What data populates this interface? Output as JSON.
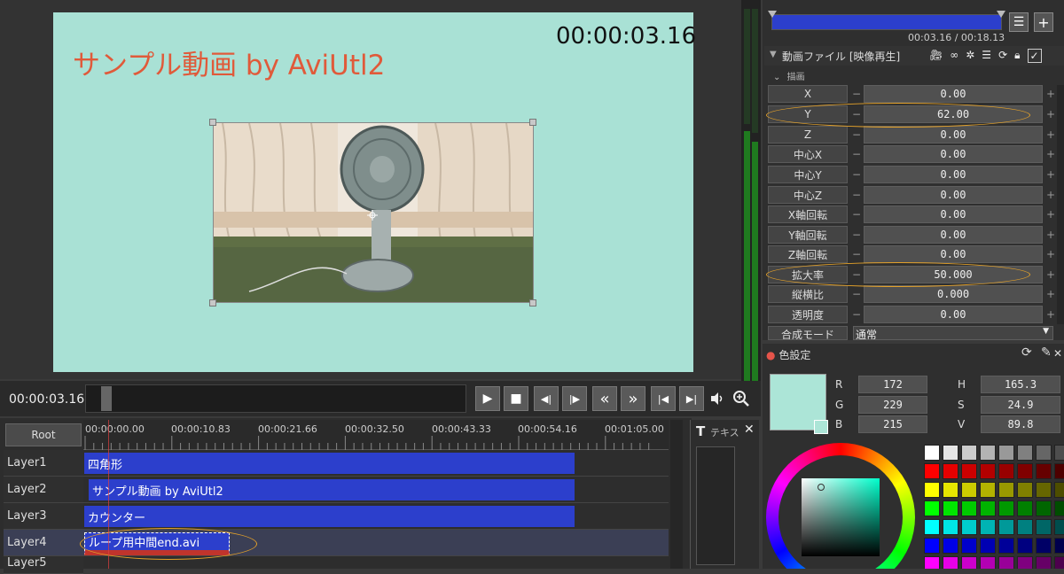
{
  "preview": {
    "canvas_title": "サンプル動画 by AviUtl2",
    "canvas_counter": "00:00:03.16",
    "background_color": "#a9e1d5",
    "title_color": "#e05a3a"
  },
  "transport": {
    "time": "00:00:03.16",
    "buttons": [
      "play",
      "stop",
      "prev-frame",
      "next-frame",
      "rewind",
      "fast-forward",
      "to-start",
      "to-end"
    ],
    "button_glyphs": [
      "▶",
      "■",
      "◀|",
      "|▶",
      "«",
      "»",
      "|◀",
      "▶|"
    ],
    "volume_icon": "speaker-icon",
    "zoom_icon": "zoom-icon"
  },
  "timeline": {
    "root_label": "Root",
    "ticks": [
      "00:00:00.00",
      "00:00:10.83",
      "00:00:21.66",
      "00:00:32.50",
      "00:00:43.33",
      "00:00:54.16",
      "00:01:05.00"
    ],
    "layers": [
      {
        "label": "Layer1",
        "clip": "四角形"
      },
      {
        "label": "Layer2",
        "clip": "サンプル動画 by AviUtl2"
      },
      {
        "label": "Layer3",
        "clip": "カウンター"
      },
      {
        "label": "Layer4",
        "clip": "ループ用中間end.avi"
      },
      {
        "label": "Layer5",
        "clip": ""
      }
    ],
    "clip_color": "#2c3fcc",
    "text_panel_label": "テキスト"
  },
  "object_panel": {
    "time": "00:03.16 / 00:18.13",
    "header": "動画ファイル [映像再生]",
    "section": "描画",
    "properties": [
      {
        "name": "X",
        "value": "0.00"
      },
      {
        "name": "Y",
        "value": "62.00"
      },
      {
        "name": "Z",
        "value": "0.00"
      },
      {
        "name": "中心X",
        "value": "0.00"
      },
      {
        "name": "中心Y",
        "value": "0.00"
      },
      {
        "name": "中心Z",
        "value": "0.00"
      },
      {
        "name": "X軸回転",
        "value": "0.00"
      },
      {
        "name": "Y軸回転",
        "value": "0.00"
      },
      {
        "name": "Z軸回転",
        "value": "0.00"
      },
      {
        "name": "拡大率",
        "value": "50.000"
      },
      {
        "name": "縦横比",
        "value": "0.000"
      },
      {
        "name": "透明度",
        "value": "0.00"
      }
    ],
    "blend_label": "合成モード",
    "blend_value": "通常"
  },
  "color_panel": {
    "title": "色設定",
    "swatch": "#ace5d7",
    "rgb": [
      {
        "k": "R",
        "v": "172"
      },
      {
        "k": "G",
        "v": "229"
      },
      {
        "k": "B",
        "v": "215"
      }
    ],
    "hsv": [
      {
        "k": "H",
        "v": "165.3"
      },
      {
        "k": "S",
        "v": "24.9"
      },
      {
        "k": "V",
        "v": "89.8"
      }
    ],
    "palette": [
      [
        "#ffffff",
        "#e6e6e6",
        "#cccccc",
        "#b3b3b3",
        "#999999",
        "#808080",
        "#666666",
        "#4d4d4d"
      ],
      [
        "#ff0000",
        "#e60000",
        "#cc0000",
        "#b30000",
        "#990000",
        "#800000",
        "#660000",
        "#4d0000"
      ],
      [
        "#ffff00",
        "#e6e600",
        "#cccc00",
        "#b3b300",
        "#999900",
        "#808000",
        "#666600",
        "#4d4d00"
      ],
      [
        "#00ff00",
        "#00e600",
        "#00cc00",
        "#00b300",
        "#009900",
        "#008000",
        "#006600",
        "#004d00"
      ],
      [
        "#00ffff",
        "#00e6e6",
        "#00cccc",
        "#00b3b3",
        "#009999",
        "#008080",
        "#006666",
        "#004d4d"
      ],
      [
        "#0000ff",
        "#0000e6",
        "#0000cc",
        "#0000b3",
        "#000099",
        "#000080",
        "#000066",
        "#00004d"
      ],
      [
        "#ff00ff",
        "#e600e6",
        "#cc00cc",
        "#b300b3",
        "#990099",
        "#800080",
        "#660066",
        "#4d004d"
      ]
    ]
  }
}
